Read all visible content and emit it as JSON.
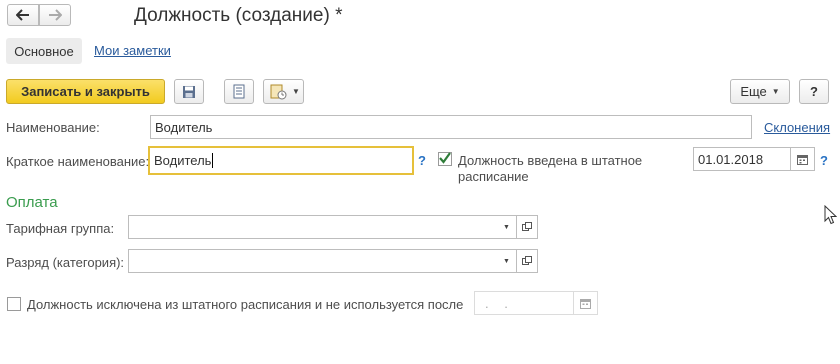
{
  "window": {
    "title": "Должность (создание) *"
  },
  "nav": {
    "back_icon": "arrow-left-icon",
    "forward_icon": "arrow-right-icon"
  },
  "tabs": [
    {
      "label": "Основное",
      "active": true
    },
    {
      "label": "Мои заметки",
      "active": false
    }
  ],
  "toolbar": {
    "save_close_label": "Записать и закрыть",
    "save_icon": "floppy-disk-icon",
    "list_icon": "document-list-icon",
    "report_icon": "report-menu-icon",
    "more_label": "Еще",
    "help_label": "?"
  },
  "form": {
    "name_label": "Наименование:",
    "name_value": "Водитель",
    "declensions_link": "Склонения",
    "short_name_label": "Краткое наименование:",
    "short_name_value": "Водитель",
    "help_mark": "?",
    "staffing_check_label": "Должность введена в штатное расписание",
    "staffing_checked": true,
    "staffing_date": "01.01.2018",
    "payment_section": "Оплата",
    "tariff_group_label": "Тарифная группа:",
    "tariff_group_value": "",
    "grade_label": "Разряд (категория):",
    "grade_value": "",
    "excluded_label": "Должность исключена из штатного расписания и не используется после",
    "excluded_checked": false,
    "excluded_date_placeholder": ". ."
  },
  "colors": {
    "accent_yellow": "#f7d52f",
    "link_blue": "#2a5b9c",
    "section_green": "#3a9c4e",
    "focus_border": "#e6c03a"
  }
}
